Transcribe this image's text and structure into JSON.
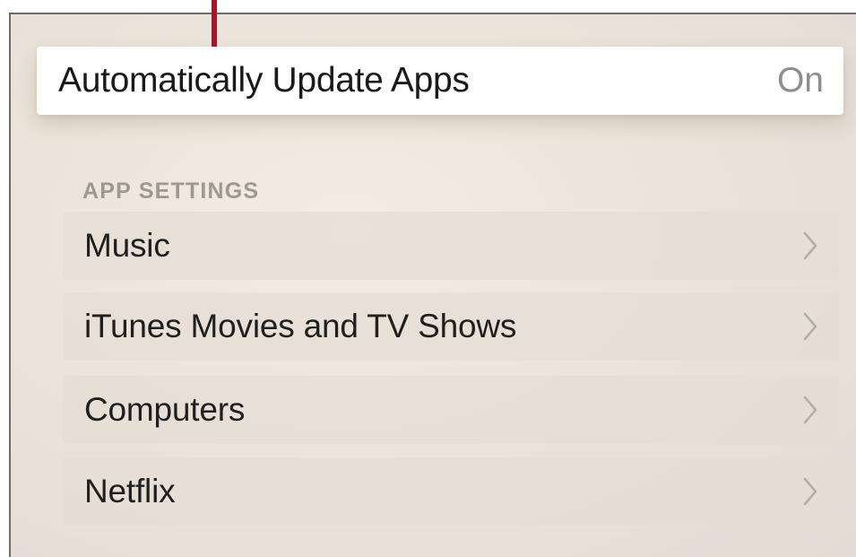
{
  "focused_setting": {
    "label": "Automatically Update Apps",
    "value": "On"
  },
  "app_settings": {
    "header": "APP SETTINGS",
    "items": [
      {
        "label": "Music",
        "icon": "chevron-right-icon"
      },
      {
        "label": "iTunes Movies and TV Shows",
        "icon": "chevron-right-icon"
      },
      {
        "label": "Computers",
        "icon": "chevron-right-icon"
      },
      {
        "label": "Netflix",
        "icon": "chevron-right-icon"
      }
    ]
  },
  "colors": {
    "callout": "#a3162a",
    "background": "#ece4da",
    "focused_row": "#ffffff",
    "secondary_text": "#8e8e8e"
  }
}
